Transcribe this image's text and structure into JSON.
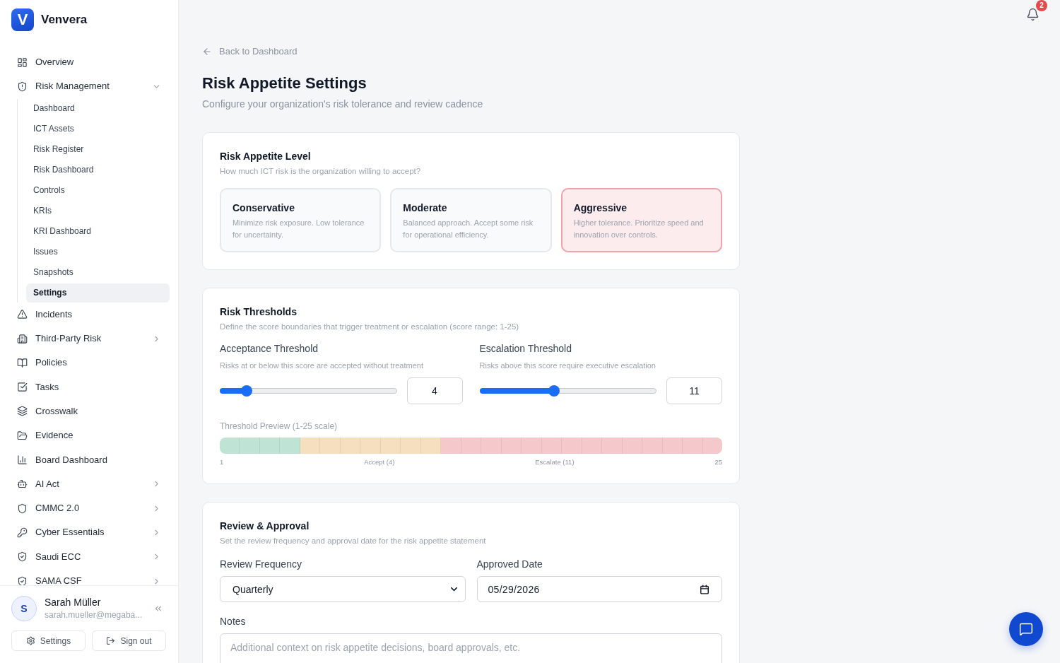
{
  "app": {
    "logo_mark": "V",
    "name": "Venvera"
  },
  "sidebar": {
    "items": [
      {
        "label": "Overview",
        "kind": "link",
        "selected": false
      },
      {
        "label": "Risk Management",
        "kind": "group",
        "expanded": true,
        "selected": false,
        "children": [
          {
            "label": "Dashboard",
            "selected": false
          },
          {
            "label": "ICT Assets",
            "selected": false
          },
          {
            "label": "Risk Register",
            "selected": false
          },
          {
            "label": "Risk Dashboard",
            "selected": false
          },
          {
            "label": "Controls",
            "selected": false
          },
          {
            "label": "KRIs",
            "selected": false
          },
          {
            "label": "KRI Dashboard",
            "selected": false
          },
          {
            "label": "Issues",
            "selected": false
          },
          {
            "label": "Snapshots",
            "selected": false
          },
          {
            "label": "Settings",
            "selected": true
          }
        ]
      },
      {
        "label": "Incidents",
        "kind": "link",
        "selected": false
      },
      {
        "label": "Third-Party Risk",
        "kind": "group",
        "expanded": false,
        "selected": false
      },
      {
        "label": "Policies",
        "kind": "link",
        "selected": false
      },
      {
        "label": "Tasks",
        "kind": "link",
        "selected": false
      },
      {
        "label": "Crosswalk",
        "kind": "link",
        "selected": false
      },
      {
        "label": "Evidence",
        "kind": "link",
        "selected": false
      },
      {
        "label": "Board Dashboard",
        "kind": "link",
        "selected": false
      },
      {
        "label": "AI Act",
        "kind": "group",
        "expanded": false,
        "selected": false
      },
      {
        "label": "CMMC 2.0",
        "kind": "group",
        "expanded": false,
        "selected": false
      },
      {
        "label": "Cyber Essentials",
        "kind": "group",
        "expanded": false,
        "selected": false
      },
      {
        "label": "Saudi ECC",
        "kind": "group",
        "expanded": false,
        "selected": false
      },
      {
        "label": "SAMA CSF",
        "kind": "group",
        "expanded": false,
        "selected": false
      }
    ],
    "user": {
      "initial": "S",
      "name": "Sarah Müller",
      "email": "sarah.mueller@megaba..."
    },
    "footer_buttons": [
      "Settings",
      "Sign out"
    ]
  },
  "notifications": {
    "count": "2"
  },
  "page": {
    "back_link": "Back to Dashboard",
    "title": "Risk Appetite Settings",
    "subtitle": "Configure your organization's risk tolerance and review cadence"
  },
  "appetite": {
    "title": "Risk Appetite Level",
    "subtitle": "How much ICT risk is the organization willing to accept?",
    "options": [
      {
        "title": "Conservative",
        "description": "Minimize risk exposure. Low tolerance for uncertainty.",
        "selected": false
      },
      {
        "title": "Moderate",
        "description": "Balanced approach. Accept some risk for operational efficiency.",
        "selected": false
      },
      {
        "title": "Aggressive",
        "description": "Higher tolerance. Prioritize speed and innovation over controls.",
        "selected": true
      }
    ]
  },
  "thresholds": {
    "title": "Risk Thresholds",
    "subtitle": "Define the score boundaries that trigger treatment or escalation (score range: 1-25)",
    "items": [
      {
        "label": "Acceptance Threshold",
        "description": "Risks at or below this score are accepted without treatment",
        "level": 0.125,
        "value": "4"
      },
      {
        "label": "Escalation Threshold",
        "description": "Risks above this score require executive escalation",
        "level": 0.417,
        "value": "11"
      }
    ],
    "preview": {
      "title": "Threshold Preview (1-25 scale)",
      "scale_labels": [
        "1",
        "Accept (4)",
        "Escalate (11)",
        "25"
      ]
    }
  },
  "review": {
    "title": "Review & Approval",
    "subtitle": "Set the review frequency and approval date for the risk appetite statement",
    "frequency": {
      "label": "Review Frequency",
      "value": "Quarterly"
    },
    "approved_date": {
      "label": "Approved Date",
      "value": "05/29/2026"
    },
    "notes": {
      "label": "Notes",
      "placeholder": "Additional context on risk appetite decisions, board approvals, etc."
    }
  }
}
